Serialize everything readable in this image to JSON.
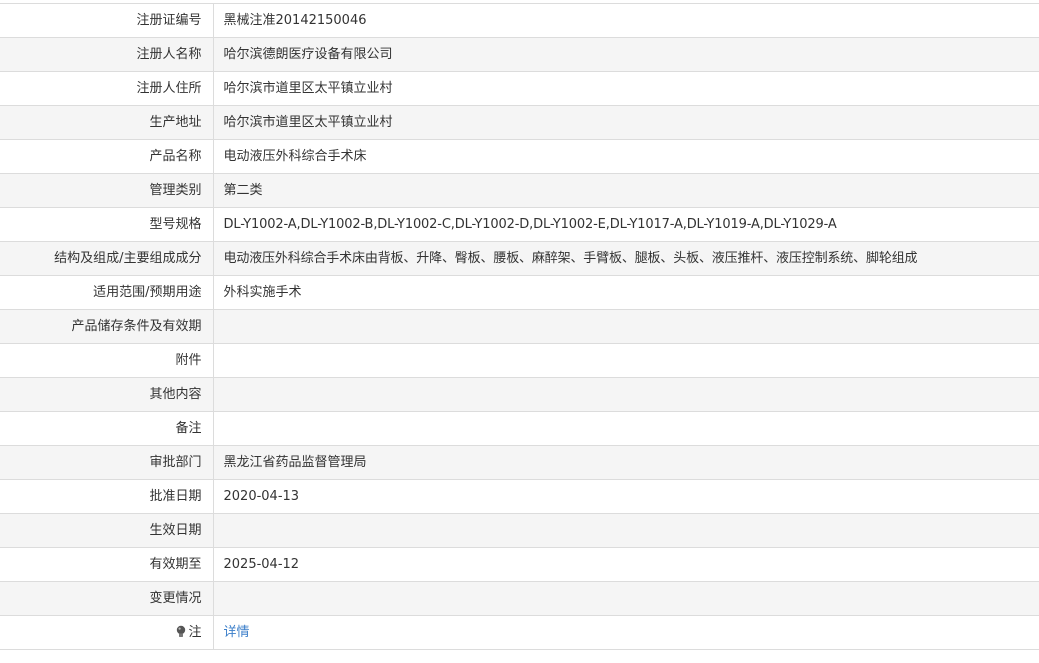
{
  "rows": [
    {
      "label": "注册证编号",
      "value": "黑械注准20142150046"
    },
    {
      "label": "注册人名称",
      "value": "哈尔滨德朗医疗设备有限公司"
    },
    {
      "label": "注册人住所",
      "value": "哈尔滨市道里区太平镇立业村"
    },
    {
      "label": "生产地址",
      "value": "哈尔滨市道里区太平镇立业村"
    },
    {
      "label": "产品名称",
      "value": "电动液压外科综合手术床"
    },
    {
      "label": "管理类别",
      "value": "第二类"
    },
    {
      "label": "型号规格",
      "value": "DL-Y1002-A,DL-Y1002-B,DL-Y1002-C,DL-Y1002-D,DL-Y1002-E,DL-Y1017-A,DL-Y1019-A,DL-Y1029-A"
    },
    {
      "label": "结构及组成/主要组成成分",
      "value": "电动液压外科综合手术床由背板、升降、臀板、腰板、麻醉架、手臂板、腿板、头板、液压推杆、液压控制系统、脚轮组成"
    },
    {
      "label": "适用范围/预期用途",
      "value": "外科实施手术"
    },
    {
      "label": "产品储存条件及有效期",
      "value": ""
    },
    {
      "label": "附件",
      "value": ""
    },
    {
      "label": "其他内容",
      "value": ""
    },
    {
      "label": "备注",
      "value": ""
    },
    {
      "label": "审批部门",
      "value": "黑龙江省药品监督管理局"
    },
    {
      "label": "批准日期",
      "value": "2020-04-13"
    },
    {
      "label": "生效日期",
      "value": ""
    },
    {
      "label": "有效期至",
      "value": "2025-04-12"
    },
    {
      "label": "变更情况",
      "value": ""
    }
  ],
  "note": {
    "icon": "bulb-icon",
    "label": "注",
    "link_text": "详情",
    "link_color": "#3a7ec9"
  }
}
